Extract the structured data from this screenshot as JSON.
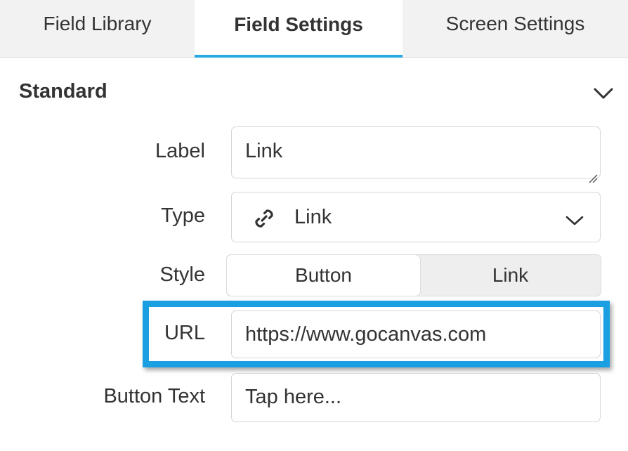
{
  "tabs": [
    {
      "label": "Field Library",
      "active": false
    },
    {
      "label": "Field Settings",
      "active": true
    },
    {
      "label": "Screen Settings",
      "active": false
    }
  ],
  "section": {
    "title": "Standard",
    "toggle_icon": "chevron-down-icon"
  },
  "form": {
    "label": {
      "label": "Label",
      "value": "Link"
    },
    "type": {
      "label": "Type",
      "value": "Link",
      "icon": "link-icon"
    },
    "style": {
      "label": "Style",
      "options": [
        "Button",
        "Link"
      ],
      "selected": "Button"
    },
    "url": {
      "label": "URL",
      "value": "https://www.gocanvas.com"
    },
    "button_text": {
      "label": "Button Text",
      "value": "Tap here..."
    }
  },
  "colors": {
    "accent": "#29a9e1",
    "highlight": "#1a9fe2",
    "text": "#333333",
    "tab_bar": "#f2f2f2"
  }
}
